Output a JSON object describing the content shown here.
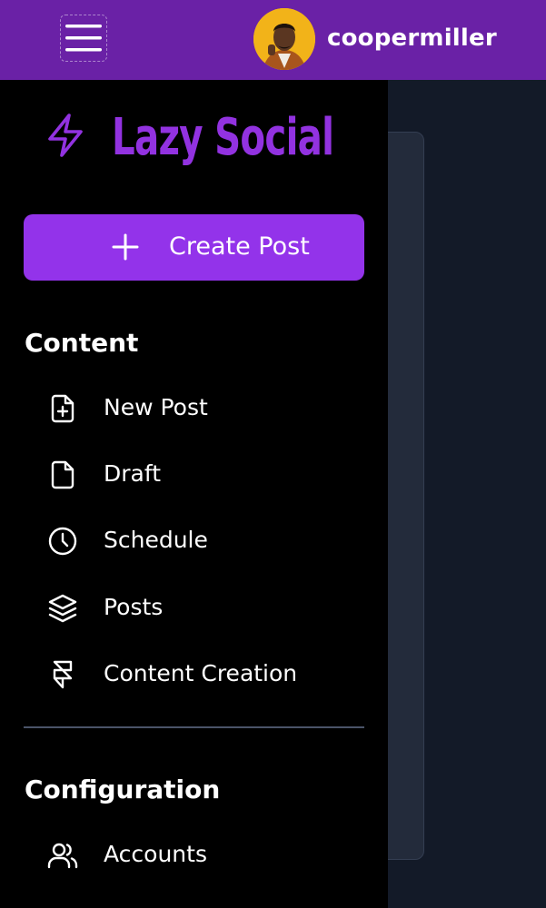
{
  "header": {
    "username": "coopermiller",
    "menu_icon": "hamburger-menu-icon",
    "avatar_icon": "user-avatar"
  },
  "sidebar": {
    "brand": {
      "name": "Lazy Social",
      "icon": "lightning-bolt-icon",
      "color": "#9232e0"
    },
    "create_button": {
      "label": "Create Post",
      "icon": "plus-icon",
      "color": "#9333ea"
    },
    "sections": [
      {
        "title": "Content",
        "items": [
          {
            "label": "New Post",
            "icon": "file-plus-icon"
          },
          {
            "label": "Draft",
            "icon": "file-icon"
          },
          {
            "label": "Schedule",
            "icon": "clock-icon"
          },
          {
            "label": "Posts",
            "icon": "layers-icon"
          },
          {
            "label": "Content Creation",
            "icon": "framer-icon"
          }
        ]
      },
      {
        "title": "Configuration",
        "items": [
          {
            "label": "Accounts",
            "icon": "users-icon"
          }
        ]
      }
    ]
  },
  "colors": {
    "topbar": "#6a21a6",
    "drawer": "#000000",
    "main_background": "#131a28",
    "card": "#232b3b"
  }
}
